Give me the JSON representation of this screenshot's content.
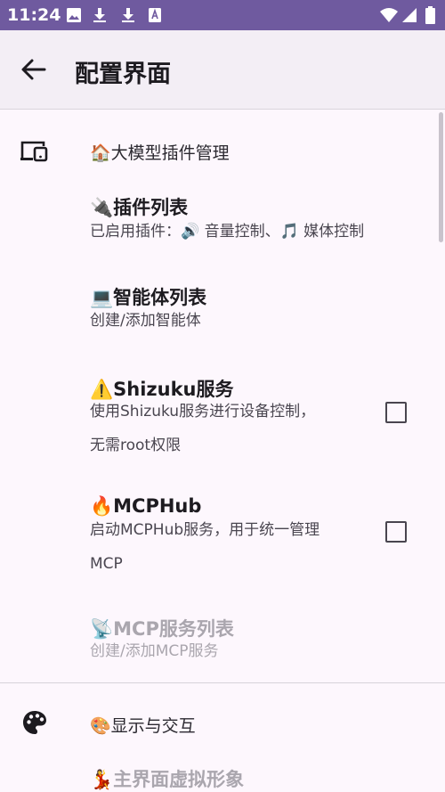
{
  "status_bar": {
    "time": "11:24",
    "icons": [
      "image-icon",
      "download-icon",
      "download-icon",
      "font-icon",
      "wifi-icon",
      "signal-icon",
      "battery-icon"
    ]
  },
  "app_bar": {
    "title": "配置界面",
    "back_icon": "arrow-back-icon"
  },
  "categories": [
    {
      "title": "🏠大模型插件管理",
      "icon": "devices-icon",
      "items": [
        {
          "title": "🔌插件列表",
          "summary": "已启用插件：🔊 音量控制、🎵 媒体控制",
          "enabled": true,
          "has_checkbox": false
        },
        {
          "title": "💻智能体列表",
          "summary": "创建/添加智能体",
          "enabled": true,
          "has_checkbox": false
        },
        {
          "title": "⚠️Shizuku服务",
          "summary": "使用Shizuku服务进行设备控制，无需root权限",
          "enabled": true,
          "has_checkbox": true,
          "checked": false
        },
        {
          "title": "🔥MCPHub",
          "summary": "启动MCPHub服务，用于统一管理MCP",
          "enabled": true,
          "has_checkbox": true,
          "checked": false
        },
        {
          "title": "📡MCP服务列表",
          "summary": "创建/添加MCP服务",
          "enabled": false,
          "has_checkbox": false
        }
      ]
    },
    {
      "title": "🎨显示与交互",
      "icon": "palette-icon",
      "items": [
        {
          "title": "💃主界面虚拟形象",
          "summary": "",
          "enabled": false,
          "has_checkbox": false
        }
      ]
    }
  ],
  "colors": {
    "status_bar": "#6f5a9f",
    "app_bar": "#f3eef5",
    "background": "#fdf7fd",
    "disabled_text": "#aaa6ae"
  }
}
